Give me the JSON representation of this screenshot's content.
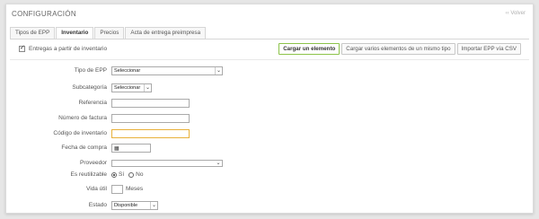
{
  "page": {
    "title": "CONFIGURACIÓN",
    "top_link": "‹‹ Volver"
  },
  "tabs": [
    {
      "label": "Tipos de EPP",
      "active": false
    },
    {
      "label": "Inventario",
      "active": true
    },
    {
      "label": "Precios",
      "active": false
    },
    {
      "label": "Acta de entrega preimpresa",
      "active": false
    }
  ],
  "inventory_toggle": {
    "label": "Entregas a partir de inventario",
    "checked": true
  },
  "actions": {
    "load_item": "Cargar un elemento",
    "load_multiple": "Cargar varios elementos de un mismo tipo",
    "import_csv": "Importar EPP vía CSV"
  },
  "form": {
    "tipo_epp": {
      "label": "Tipo de EPP",
      "value": "Seleccionar"
    },
    "subcategoria": {
      "label": "Subcategoría",
      "value": "Seleccionar"
    },
    "referencia": {
      "label": "Referencia",
      "value": ""
    },
    "numero_factura": {
      "label": "Número de factura",
      "value": ""
    },
    "codigo_inventario": {
      "label": "Código de inventario",
      "value": ""
    },
    "fecha_compra": {
      "label": "Fecha de compra",
      "value": ""
    },
    "proveedor": {
      "label": "Proveedor",
      "value": ""
    },
    "es_reutilizable": {
      "label": "Es reutilizable",
      "options": [
        "Sí",
        "No"
      ],
      "selected": "Sí"
    },
    "vida_util": {
      "label": "Vida útil",
      "value": "",
      "unit": "Meses"
    },
    "estado": {
      "label": "Estado",
      "value": "Disponible"
    }
  },
  "colors": {
    "primary_border": "#8cc34a",
    "focus_border": "#e8b13b",
    "panel_bg": "#ffffff",
    "page_bg": "#e6e6e6"
  }
}
